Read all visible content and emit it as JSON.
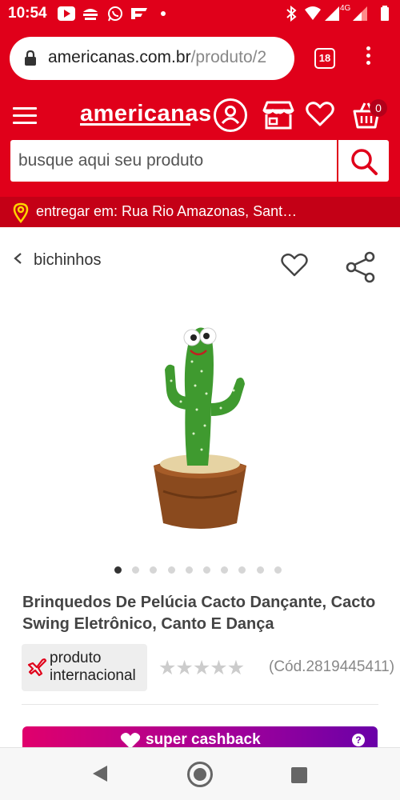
{
  "status_bar": {
    "time": "10:54",
    "network": "4G",
    "icons": [
      "youtube-icon",
      "ifood-icon",
      "whatsapp-icon",
      "flipboard-icon",
      "dot-icon",
      "bluetooth-icon",
      "wifi-icon",
      "signal-icon",
      "battery-icon"
    ]
  },
  "browser": {
    "url_domain": "americanas.com.br",
    "url_path": "/produto/2",
    "tab_count": "18"
  },
  "header": {
    "logo": "americanas",
    "cart_count": "0",
    "search_placeholder": "busque aqui seu produto"
  },
  "delivery": {
    "text": "entregar em: Rua Rio Amazonas, Sant…"
  },
  "breadcrumb": {
    "label": "bichinhos"
  },
  "carousel": {
    "total": 10,
    "active_index": 0
  },
  "product": {
    "title": "Brinquedos De Pelúcia Cacto Dançante, Cacto Swing Eletrônico, Canto E Dança",
    "badge": "produto internacional",
    "rating_stars": 5,
    "rating_filled": 0,
    "code": "(Cód.2819445411)"
  },
  "cashback": {
    "label": "super cashback",
    "info": "?"
  },
  "colors": {
    "brand_red": "#e0001a",
    "cashback_start": "#e0006c",
    "cashback_end": "#6a00a8"
  }
}
